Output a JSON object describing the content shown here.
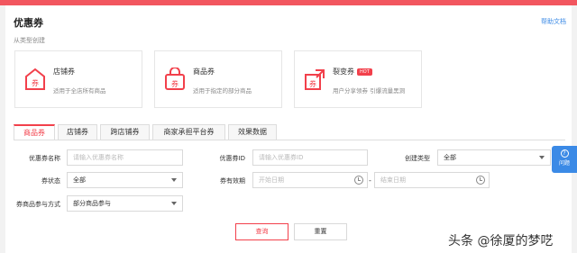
{
  "header": {
    "title": "优惠券",
    "help_link": "帮助文档",
    "subtitle": "从类型创建"
  },
  "cards": [
    {
      "name": "店铺券",
      "desc": "适用于全店所有商品",
      "icon": "store-coupon-icon",
      "badge": ""
    },
    {
      "name": "商品券",
      "desc": "适用于指定的部分商品",
      "icon": "product-coupon-icon",
      "badge": ""
    },
    {
      "name": "裂变券",
      "desc": "用户分享领券 引爆流量黑洞",
      "icon": "fission-coupon-icon",
      "badge": "HOT"
    }
  ],
  "icon_glyph": "券",
  "tabs": [
    "商品券",
    "店铺券",
    "跨店铺券",
    "商家承担平台券",
    "效果数据"
  ],
  "active_tab": "商品券",
  "filters": {
    "coupon_name_label": "优惠券名称",
    "coupon_name_placeholder": "请输入优惠券名称",
    "coupon_id_label": "优惠券ID",
    "coupon_id_placeholder": "请输入优惠券ID",
    "create_type_label": "创建类型",
    "create_type_value": "全部",
    "status_label": "券状态",
    "status_value": "全部",
    "valid_period_label": "券有效期",
    "start_placeholder": "开始日期",
    "separator": "-",
    "end_placeholder": "结束日期",
    "participation_label": "券商品参与方式",
    "participation_value": "部分商品参与"
  },
  "buttons": {
    "query": "查询",
    "reset": "重置"
  },
  "side_feedback": {
    "icon": "?",
    "label": "问题"
  },
  "watermark": "头条 @徐厦的梦呓",
  "colors": {
    "accent": "#f2404b",
    "link": "#3b8ae6",
    "topbar": "#f2565f"
  }
}
